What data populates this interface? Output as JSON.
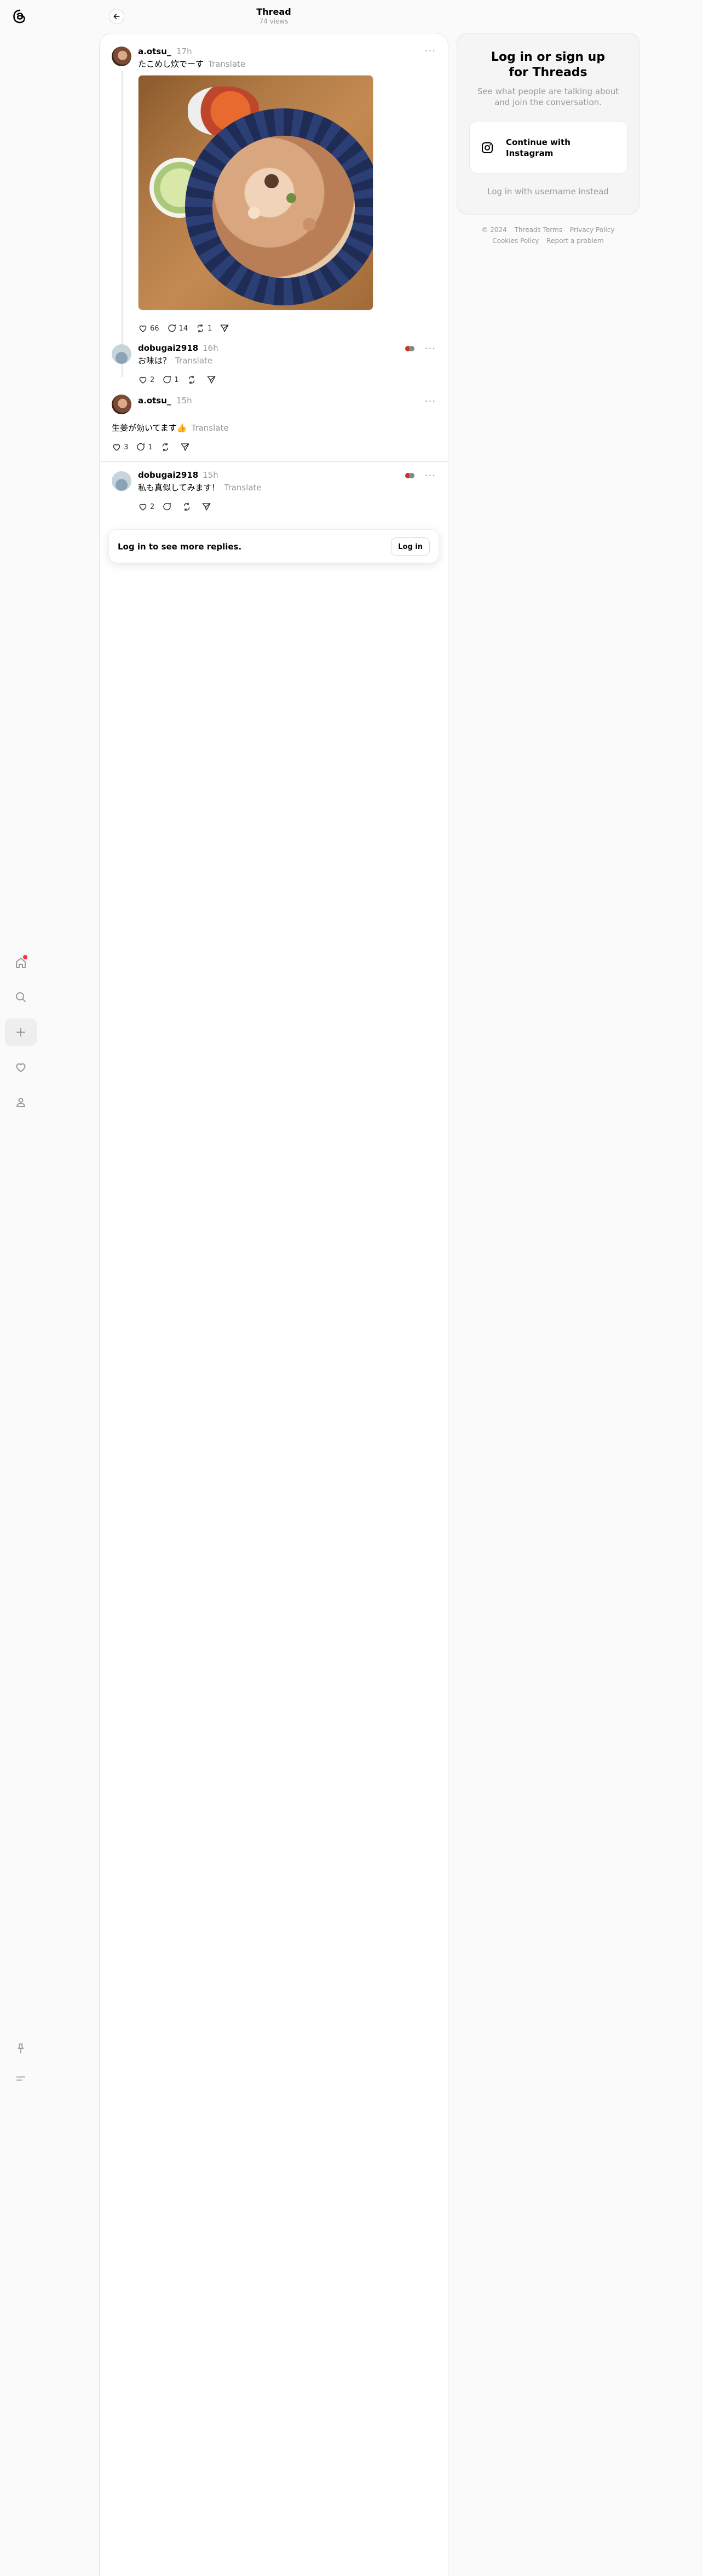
{
  "header": {
    "title": "Thread",
    "views": "74 views"
  },
  "colors": {
    "background": "#fafafa",
    "panel": "#ffffff",
    "notification_dot": "#ff3040",
    "muted_text": "#999999"
  },
  "rail": {
    "icons": [
      "threads-logo-icon",
      "home-icon",
      "search-icon",
      "create-icon",
      "activity-heart-icon",
      "profile-icon",
      "pin-icon",
      "menu-icon"
    ]
  },
  "posts": [
    {
      "username": "a.otsu_",
      "time": "17h",
      "text": "たこめし炊でーす",
      "translate": "Translate",
      "likes": "66",
      "replies": "14",
      "reposts": "1",
      "has_image": true
    },
    {
      "username": "dobugai2918",
      "time": "16h",
      "text": "お味は？",
      "translate": "Translate",
      "likes": "2",
      "replies": "1",
      "reposts": ""
    },
    {
      "username": "a.otsu_",
      "time": "15h",
      "text": "生姜が効いてます👍",
      "translate": "Translate",
      "likes": "3",
      "replies": "1",
      "reposts": ""
    },
    {
      "username": "dobugai2918",
      "time": "15h",
      "text": "私も真似してみます！",
      "translate": "Translate",
      "likes": "2",
      "replies": "",
      "reposts": ""
    }
  ],
  "login_strip": {
    "text": "Log in to see more replies.",
    "button": "Log in"
  },
  "login_card": {
    "title": "Log in or sign up for Threads",
    "subtitle": "See what people are talking about and join the conversation.",
    "instagram_button": "Continue with Instagram",
    "username_link": "Log in with username instead"
  },
  "footer": {
    "copyright": "© 2024",
    "terms": "Threads Terms",
    "privacy": "Privacy Policy",
    "cookies": "Cookies Policy",
    "report": "Report a problem"
  }
}
